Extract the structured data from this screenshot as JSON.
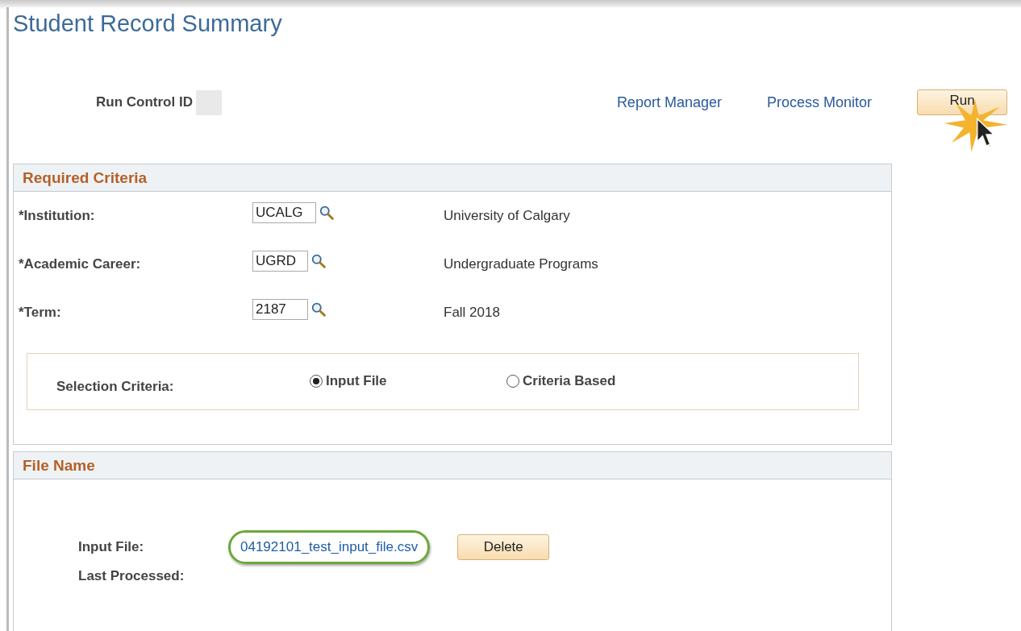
{
  "title": "Student Record Summary",
  "run_control": {
    "label": "Run Control ID"
  },
  "links": [
    "Report Manager",
    "Process Monitor"
  ],
  "run_button": {
    "label": "Run",
    "clicked": true
  },
  "required_criteria": {
    "heading": "Required Criteria",
    "fields": [
      {
        "label": "*Institution:",
        "value": "UCALG",
        "description": "University of Calgary"
      },
      {
        "label": "*Academic Career:",
        "value": "UGRD",
        "description": "Undergraduate Programs"
      },
      {
        "label": "*Term:",
        "value": "2187",
        "description": "Fall 2018"
      }
    ],
    "selection": {
      "label": "Selection Criteria:",
      "options": [
        {
          "label": "Input File",
          "selected": true
        },
        {
          "label": "Criteria Based",
          "selected": false
        }
      ]
    }
  },
  "file_name": {
    "heading": "File Name",
    "input_file_label": "Input File:",
    "input_file": "04192101_test_input_file.csv",
    "highlighted": true,
    "delete_button": "Delete",
    "last_processed_label": "Last Processed:"
  }
}
